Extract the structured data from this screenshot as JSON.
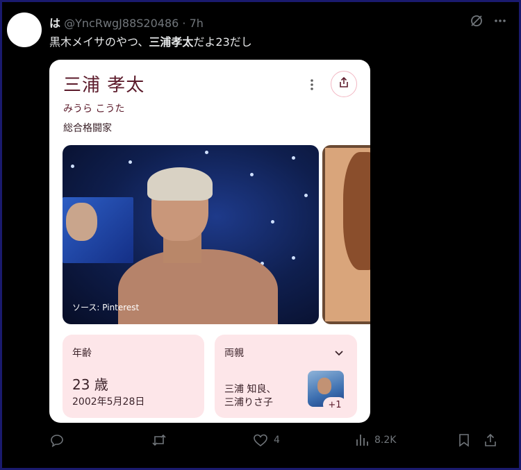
{
  "tweet": {
    "display_name": "は",
    "handle": "@YncRwgJ88S20486",
    "separator": " · ",
    "time": "7h",
    "text_before": "黒木メイサのやつ、",
    "text_bold": "三浦孝太",
    "text_after": "だよ23だし"
  },
  "card": {
    "name": "三浦 孝太",
    "kana": "みうら こうた",
    "occupation": "総合格闘家",
    "image_source": "ソース: Pinterest",
    "age_label": "年齢",
    "age_value": "23 歳",
    "birth_date": "2002年5月28日",
    "parents_label": "両親",
    "parents_line1": "三浦 知良、",
    "parents_line2": "三浦りさ子",
    "more_count": "+1"
  },
  "actions": {
    "reply_count": "",
    "retweet_count": "",
    "like_count": "4",
    "views_count": "8.2K"
  },
  "icons": [
    "grok-icon",
    "more-icon",
    "kebab-icon",
    "share-icon",
    "chevron-down-icon",
    "reply-icon",
    "retweet-icon",
    "like-icon",
    "views-icon",
    "bookmark-icon",
    "share-tweet-icon"
  ],
  "colors": {
    "background": "#000000",
    "card_text": "#5b1a2a",
    "info_box": "#fde6e9",
    "muted": "#71767b"
  }
}
